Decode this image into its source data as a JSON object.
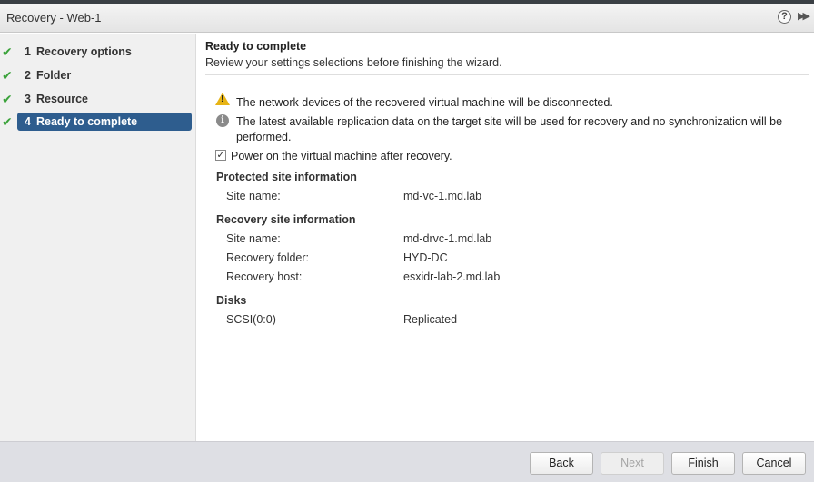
{
  "window": {
    "title": "Recovery - Web-1",
    "help_icon": "?",
    "expand_icon": "▶▶"
  },
  "steps": [
    {
      "number": "1",
      "label": "Recovery options",
      "completed": true,
      "active": false
    },
    {
      "number": "2",
      "label": "Folder",
      "completed": true,
      "active": false
    },
    {
      "number": "3",
      "label": "Resource",
      "completed": true,
      "active": false
    },
    {
      "number": "4",
      "label": "Ready to complete",
      "completed": true,
      "active": true
    }
  ],
  "main": {
    "heading": "Ready to complete",
    "subheading": "Review your settings selections before finishing the wizard.",
    "warning_text": "The network devices of the recovered virtual machine will be disconnected.",
    "info_text_line1": "The latest available replication data on the target site will be used for recovery and no synchronization will be",
    "info_text_line2": "performed.",
    "power_on_label": "Power on the virtual machine after recovery.",
    "power_on_checked": true,
    "protected_site": {
      "title": "Protected site information",
      "site_name_label": "Site name:",
      "site_name_value": "md-vc-1.md.lab"
    },
    "recovery_site": {
      "title": "Recovery site information",
      "site_name_label": "Site name:",
      "site_name_value": "md-drvc-1.md.lab",
      "folder_label": "Recovery folder:",
      "folder_value": "HYD-DC",
      "host_label": "Recovery host:",
      "host_value": "esxidr-lab-2.md.lab"
    },
    "disks": {
      "title": "Disks",
      "disk_label": "SCSI(0:0)",
      "disk_value": "Replicated"
    }
  },
  "footer": {
    "back_label": "Back",
    "next_label": "Next",
    "finish_label": "Finish",
    "cancel_label": "Cancel"
  },
  "colors": {
    "active_step": "#2e5d8e",
    "check": "#3aa23a",
    "warning": "#e7b416",
    "footer_bg": "#dedfe4"
  }
}
